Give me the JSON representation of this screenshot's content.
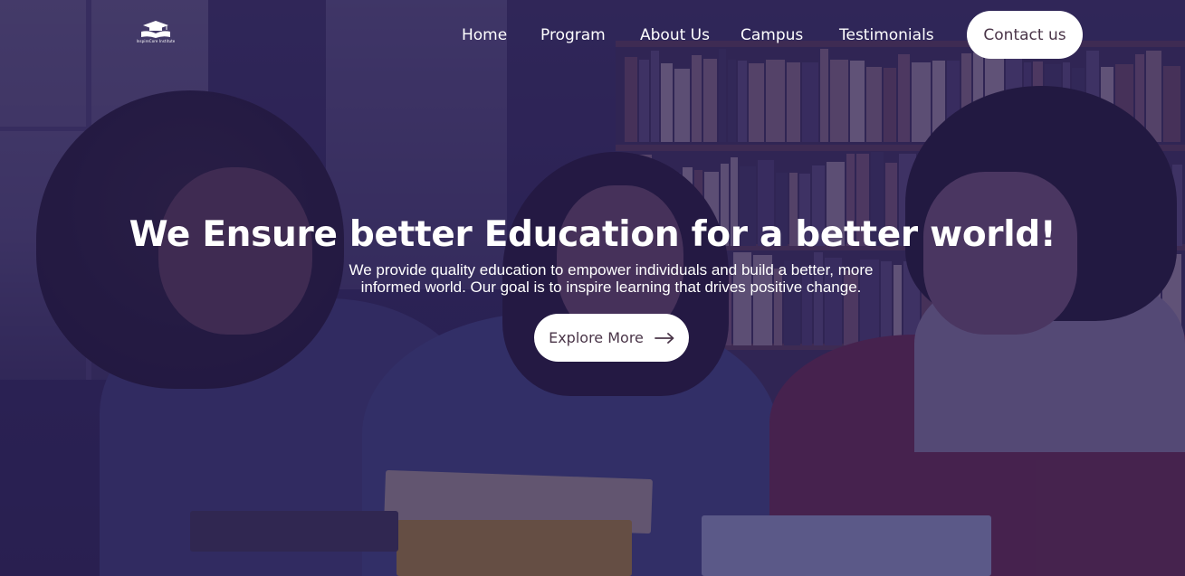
{
  "brand": {
    "logo_text": "InspireCore Institute"
  },
  "nav": {
    "items": [
      {
        "label": "Home"
      },
      {
        "label": "Program"
      },
      {
        "label": "About Us"
      },
      {
        "label": "Campus"
      },
      {
        "label": "Testimonials"
      }
    ],
    "cta_label": "Contact us"
  },
  "hero": {
    "headline": "We Ensure better Education for a better world!",
    "description_line1": "We provide quality education to empower individuals and build a better, more",
    "description_line2": "informed world. Our goal is to inspire learning that drives positive change.",
    "button_label": "Explore More",
    "button_icon": "arrow-right-icon"
  },
  "colors": {
    "overlay": "#281e5a",
    "button_bg": "#ffffff",
    "button_text": "#4a3548",
    "text": "#ffffff"
  }
}
